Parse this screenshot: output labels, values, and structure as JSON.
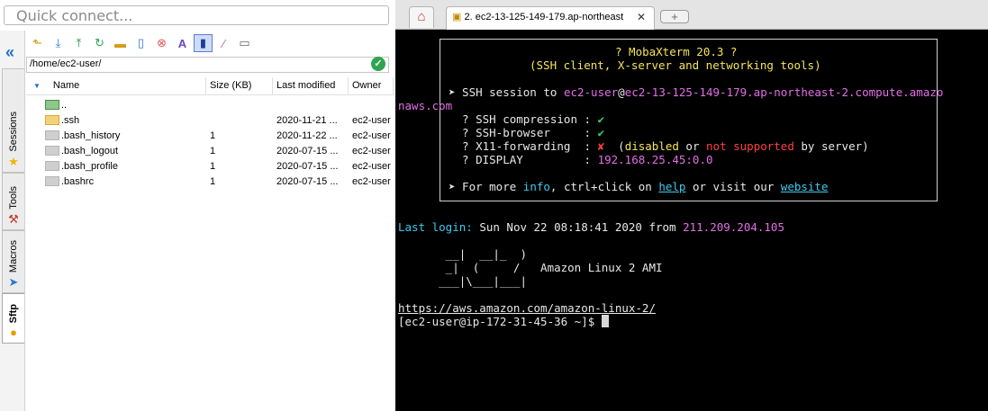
{
  "quick_connect": {
    "placeholder": "Quick connect..."
  },
  "side_tabs": [
    "Sessions",
    "Tools",
    "Macros",
    "Sftp"
  ],
  "sftp": {
    "path": "/home/ec2-user/",
    "columns": [
      "Name",
      "Size (KB)",
      "Last modified",
      "Owner"
    ],
    "rows": [
      {
        "name": "..",
        "size": "",
        "modified": "",
        "owner": "",
        "type": "up"
      },
      {
        "name": ".ssh",
        "size": "",
        "modified": "2020-11-21 ...",
        "owner": "ec2-user",
        "type": "folder"
      },
      {
        "name": ".bash_history",
        "size": "1",
        "modified": "2020-11-22 ...",
        "owner": "ec2-user",
        "type": "file"
      },
      {
        "name": ".bash_logout",
        "size": "1",
        "modified": "2020-07-15 ...",
        "owner": "ec2-user",
        "type": "file"
      },
      {
        "name": ".bash_profile",
        "size": "1",
        "modified": "2020-07-15 ...",
        "owner": "ec2-user",
        "type": "file"
      },
      {
        "name": ".bashrc",
        "size": "1",
        "modified": "2020-07-15 ...",
        "owner": "ec2-user",
        "type": "file"
      }
    ]
  },
  "tabs": {
    "session_label": "2. ec2-13-125-149-179.ap-northeast"
  },
  "terminal": {
    "banner_title": "? MobaXterm 20.3 ?",
    "banner_sub": "(SSH client, X-server and networking tools)",
    "ssh_prefix": "➤ SSH session to ",
    "ssh_user": "ec2-user",
    "ssh_at": "@",
    "ssh_host_1": "ec2-13-125-149-179.ap-northeast-2.compute.amazo",
    "ssh_host_2": "naws.com",
    "compression_label": "  ? SSH compression : ",
    "browser_label": "  ? SSH-browser     : ",
    "x11_label": "  ? X11-forwarding  : ",
    "check": "✔",
    "cross": "✘",
    "x11_open": "  (",
    "x11_disabled": "disabled",
    "x11_or": " or ",
    "x11_not": "not supported",
    "x11_by": " by server)",
    "display_label": "  ? DISPLAY         : ",
    "display_value": "192.168.25.45:0.0",
    "more_1": "➤ For more ",
    "more_info": "info",
    "more_2": ", ctrl+click on ",
    "more_help": "help",
    "more_3": " or visit our ",
    "more_website": "website",
    "last_login_label": "Last login:",
    "last_login_date": " Sun Nov 22 08:18:41 2020 from ",
    "last_login_ip": "211.209.204.105",
    "art_1": "       __|  __|_  )",
    "art_2": "       _|  (     /   Amazon Linux 2 AMI",
    "art_3": "      ___|\\___|___|",
    "url": "https://aws.amazon.com/amazon-linux-2/",
    "prompt": "[ec2-user@ip-172-31-45-36 ~]$ "
  }
}
